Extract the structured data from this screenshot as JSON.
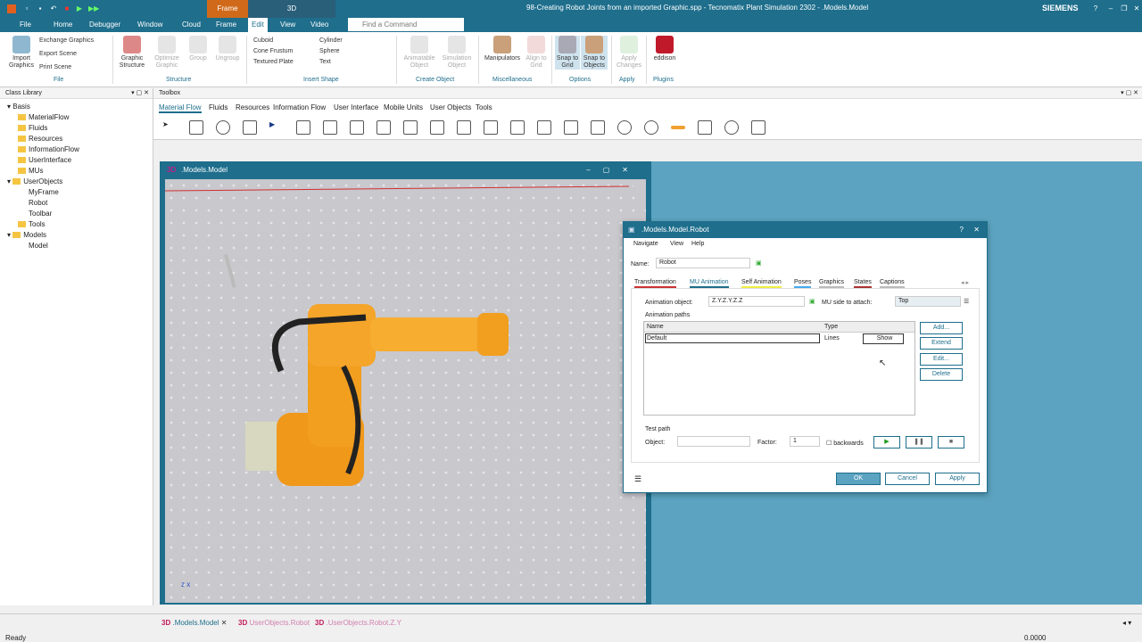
{
  "window": {
    "title": "98-Creating Robot Joints from an imported Graphic.spp - Tecnomatix Plant Simulation 2302 - .Models.Model",
    "brand": "SIEMENS",
    "ctx_frame": "Frame",
    "ctx_3d": "3D"
  },
  "ribbon_tabs": [
    "File",
    "Home",
    "Debugger",
    "Window",
    "Cloud",
    "Frame",
    "Edit",
    "View",
    "Video"
  ],
  "command_search": {
    "placeholder": "Find a Command"
  },
  "ribbon": {
    "file": {
      "import": "Import Graphics",
      "exchange": "Exchange Graphics",
      "export": "Export Scene",
      "print": "Print Scene",
      "group": "File"
    },
    "structure": {
      "graphic": "Graphic Structure",
      "optimize": "Optimize Graphic",
      "group_btn": "Group",
      "ungroup": "Ungroup",
      "group": "Structure"
    },
    "insert": {
      "cuboid": "Cuboid",
      "cylinder": "Cylinder",
      "cone": "Cone Frustum",
      "sphere": "Sphere",
      "plate": "Textured Plate",
      "text": "Text",
      "group": "Insert Shape"
    },
    "create": {
      "animatable": "Animatable Object",
      "simulation": "Simulation Object",
      "group": "Create Object"
    },
    "misc": {
      "manipulators": "Manipulators",
      "align": "Align to Grid",
      "group": "Miscellaneous"
    },
    "options": {
      "snap_grid": "Snap to Grid",
      "snap_objects": "Snap to Objects",
      "group": "Options"
    },
    "apply": {
      "apply_changes": "Apply Changes",
      "group": "Apply"
    },
    "plugins": {
      "eddison": "eddison",
      "group": "Plugins"
    }
  },
  "class_library": {
    "title": "Class Library",
    "items": [
      "Basis",
      "MaterialFlow",
      "Fluids",
      "Resources",
      "InformationFlow",
      "UserInterface",
      "MUs",
      "UserObjects",
      "MyFrame",
      "Robot",
      "Toolbar",
      "Tools",
      "Models",
      "Model"
    ]
  },
  "toolbox": {
    "title": "Toolbox",
    "tabs": [
      "Material Flow",
      "Fluids",
      "Resources",
      "Information Flow",
      "User Interface",
      "Mobile Units",
      "User Objects",
      "Tools"
    ]
  },
  "model_window": {
    "title": ".Models.Model",
    "badge": "3D"
  },
  "dialog": {
    "title": ".Models.Model.Robot",
    "menu": [
      "Navigate",
      "View",
      "Help"
    ],
    "name_label": "Name:",
    "name_value": "Robot",
    "tabs": [
      "Transformation",
      "MU Animation",
      "Self Animation",
      "Poses",
      "Graphics",
      "States",
      "Captions"
    ],
    "anim_obj_label": "Animation object:",
    "anim_obj_value": "Z.Y.Z.Y.Z.Z",
    "mu_side_label": "MU side to attach:",
    "mu_side_value": "Top",
    "paths_label": "Animation paths",
    "col_name": "Name",
    "col_type": "Type",
    "row_name": "Default",
    "row_type": "Lines",
    "row_show": "Show",
    "add": "Add...",
    "extend": "Extend",
    "edit": "Edit...",
    "delete": "Delete",
    "test_path": "Test path",
    "object_label": "Object:",
    "factor_label": "Factor:",
    "factor_value": "1",
    "backwards": "backwards",
    "ok": "OK",
    "cancel": "Cancel",
    "apply": "Apply"
  },
  "bottom_tabs": [
    ".Models.Model",
    "UserObjects.Robot",
    ".UserObjects.Robot.Z.Y"
  ],
  "bottom_badge": "3D",
  "status": {
    "left": "Ready",
    "right": "0.0000"
  }
}
